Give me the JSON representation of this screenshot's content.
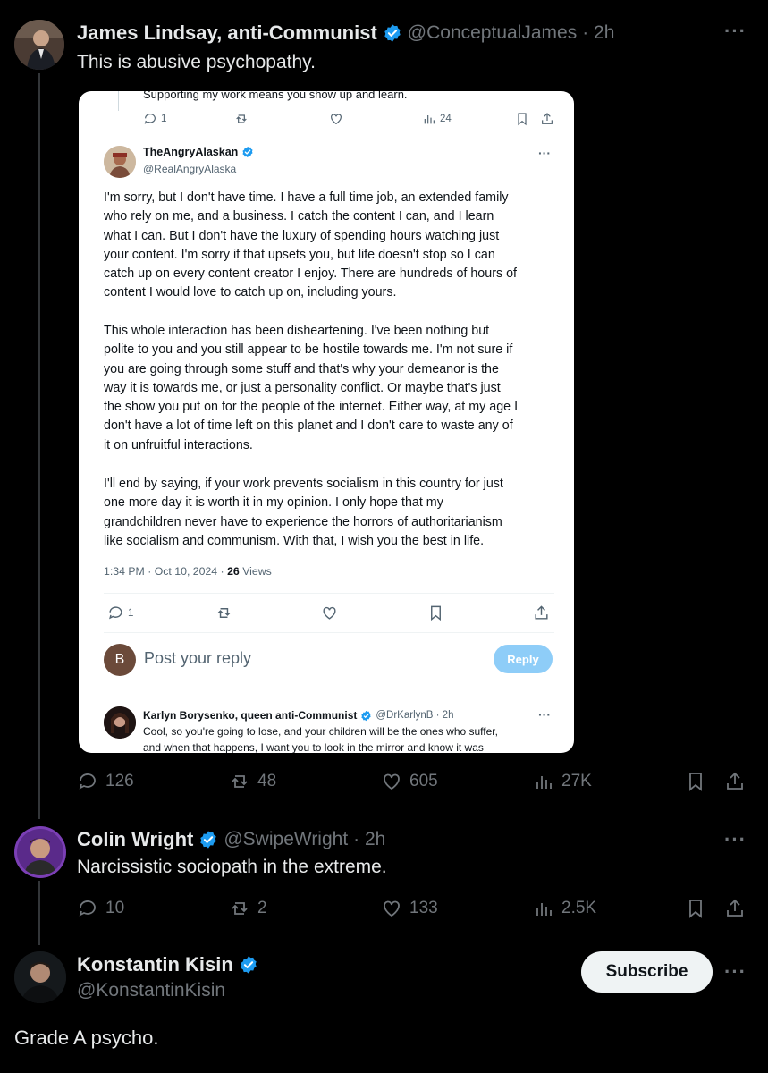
{
  "tweet1": {
    "name": "James Lindsay, anti-Communist",
    "handle": "@ConceptualJames",
    "time": "· 2h",
    "text": "This is abusive psychopathy.",
    "stats": {
      "replies": "126",
      "reposts": "48",
      "likes": "605",
      "views": "27K"
    }
  },
  "embedded": {
    "top_cut_text": "Supporting my work means you show up and learn.",
    "top_stats": {
      "replies": "1",
      "views": "24"
    },
    "author_name": "TheAngryAlaskan",
    "author_handle": "@RealAngryAlaska",
    "paragraph1": [
      "I'm sorry, but I don't have time. I have a full time job, an extended family",
      "who rely on me, and a business. I catch the content I can, and I learn",
      "what I can. But I don't have the luxury of spending hours watching just",
      "your content. I'm sorry if that upsets you, but life doesn't stop so I can",
      "catch up on every content creator I enjoy. There are hundreds of hours of",
      "content I would love to catch up on, including yours."
    ],
    "paragraph2": [
      "This whole interaction has been disheartening. I've been nothing but",
      "polite to you and you still appear to be hostile towards me. I'm not sure if",
      "you are going through some stuff and that's why your demeanor is the",
      "way it is towards me, or just a personality conflict. Or maybe that's just",
      "the show you put on for the people of the internet. Either way, at my age I",
      "don't have a lot of time left on this planet and I don't care to waste any of",
      "it on unfruitful interactions."
    ],
    "paragraph3": [
      "I'll end by saying, if your work prevents socialism in this country for just",
      "one more day it is worth it in my opinion. I only hope that my",
      "grandchildren never have to experience the horrors of authoritarianism",
      "like socialism and communism. With that, I wish you the best in life."
    ],
    "timestamp": "1:34 PM · Oct 10, 2024 ·",
    "views_count": "26",
    "views_label": "Views",
    "bottom_stats": {
      "replies": "1"
    },
    "reply_avatar_letter": "B",
    "reply_placeholder": "Post your reply",
    "reply_button": "Reply",
    "reply_name": "Karlyn Borysenko, queen anti-Communist",
    "reply_handle": "@DrKarlynB · 2h",
    "reply_text_1": "Cool, so you're going to lose, and your children will be the ones who suffer,",
    "reply_text_2": "and when that happens, I want you to look in the mirror and know it was"
  },
  "tweet2": {
    "name": "Colin Wright",
    "handle": "@SwipeWright",
    "time": "· 2h",
    "text": "Narcissistic sociopath in the extreme.",
    "stats": {
      "replies": "10",
      "reposts": "2",
      "likes": "133",
      "views": "2.5K"
    }
  },
  "tweet3": {
    "name": "Konstantin Kisin",
    "handle": "@KonstantinKisin",
    "subscribe_label": "Subscribe",
    "text": "Grade A psycho."
  },
  "colors": {
    "verified": "#1d9bf0",
    "muted": "#71767b",
    "background": "#000000"
  }
}
